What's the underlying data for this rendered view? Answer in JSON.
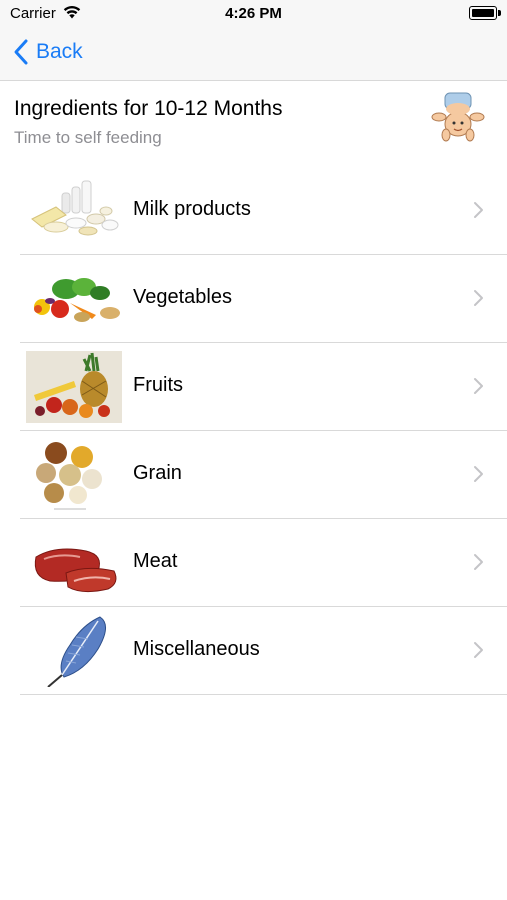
{
  "status_bar": {
    "carrier": "Carrier",
    "time": "4:26 PM"
  },
  "nav": {
    "back_label": "Back"
  },
  "header": {
    "title": "Ingredients for 10-12 Months",
    "subtitle": "Time to self feeding"
  },
  "rows": [
    {
      "label": "Milk products"
    },
    {
      "label": "Vegetables"
    },
    {
      "label": "Fruits"
    },
    {
      "label": "Grain"
    },
    {
      "label": "Meat"
    },
    {
      "label": "Miscellaneous"
    }
  ],
  "colors": {
    "accent": "#1a7cf6",
    "subtitle": "#8e8e93",
    "separator": "#d9d9d9"
  }
}
